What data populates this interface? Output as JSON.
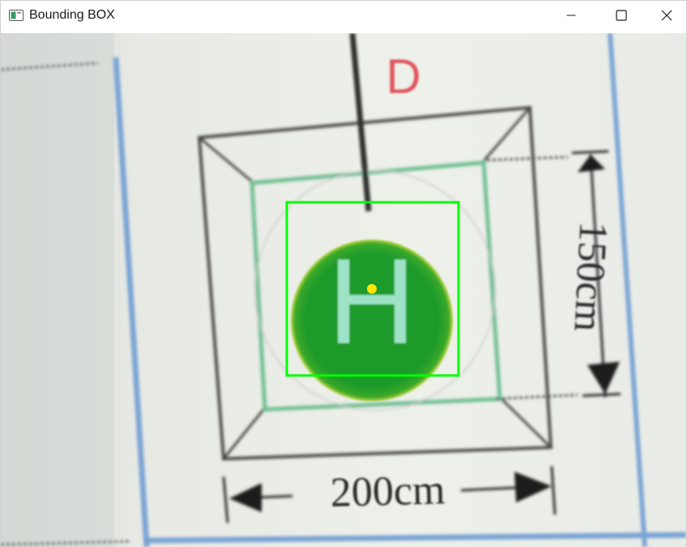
{
  "window": {
    "title": "Bounding BOX",
    "controls": {
      "minimize": "minimize-icon",
      "maximize": "maximize-icon",
      "close": "close-icon"
    }
  },
  "scene": {
    "marker_letter": "H",
    "direction_letter": "D",
    "width_dimension": "200cm",
    "height_dimension": "150cm"
  },
  "colors": {
    "bounding_box": "#00ff00",
    "center_dot": "#ffe600",
    "helipad_fill": "#1f9a2a",
    "direction_letter": "#e0585e",
    "frame_blue": "#6f9fd0"
  }
}
